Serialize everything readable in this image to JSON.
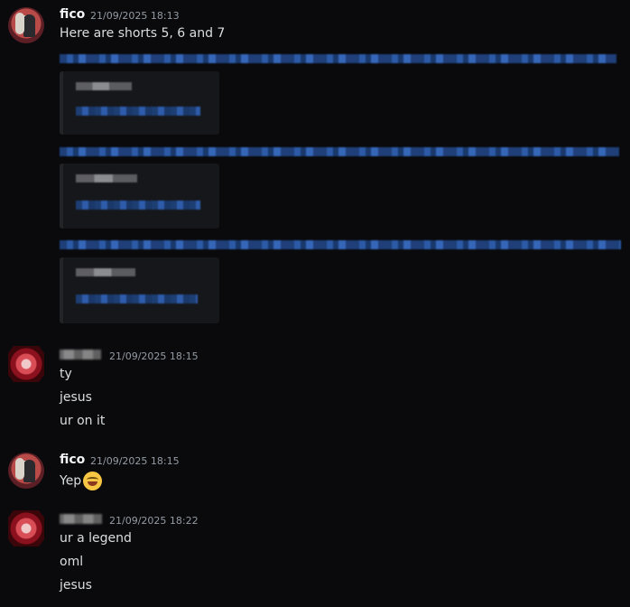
{
  "messages": [
    {
      "author": "fico",
      "timestamp": "21/09/2025 18:13",
      "lines": [
        "Here are shorts 5, 6 and 7"
      ]
    },
    {
      "author": "",
      "timestamp": "21/09/2025 18:15",
      "lines": [
        "ty",
        "jesus",
        "ur on it"
      ]
    },
    {
      "author": "fico",
      "timestamp": "21/09/2025 18:15",
      "lines": [
        "Yep"
      ],
      "emoji": "joy-emoji"
    },
    {
      "author": "",
      "timestamp": "21/09/2025 18:22",
      "lines": [
        "ur a legend",
        "oml",
        "jesus"
      ]
    }
  ],
  "colors": {
    "background": "#0a0a0c",
    "text": "#dbdee1",
    "timestamp": "#949ba4",
    "link": "#2c5aa6",
    "embed_bg": "#16171a"
  }
}
